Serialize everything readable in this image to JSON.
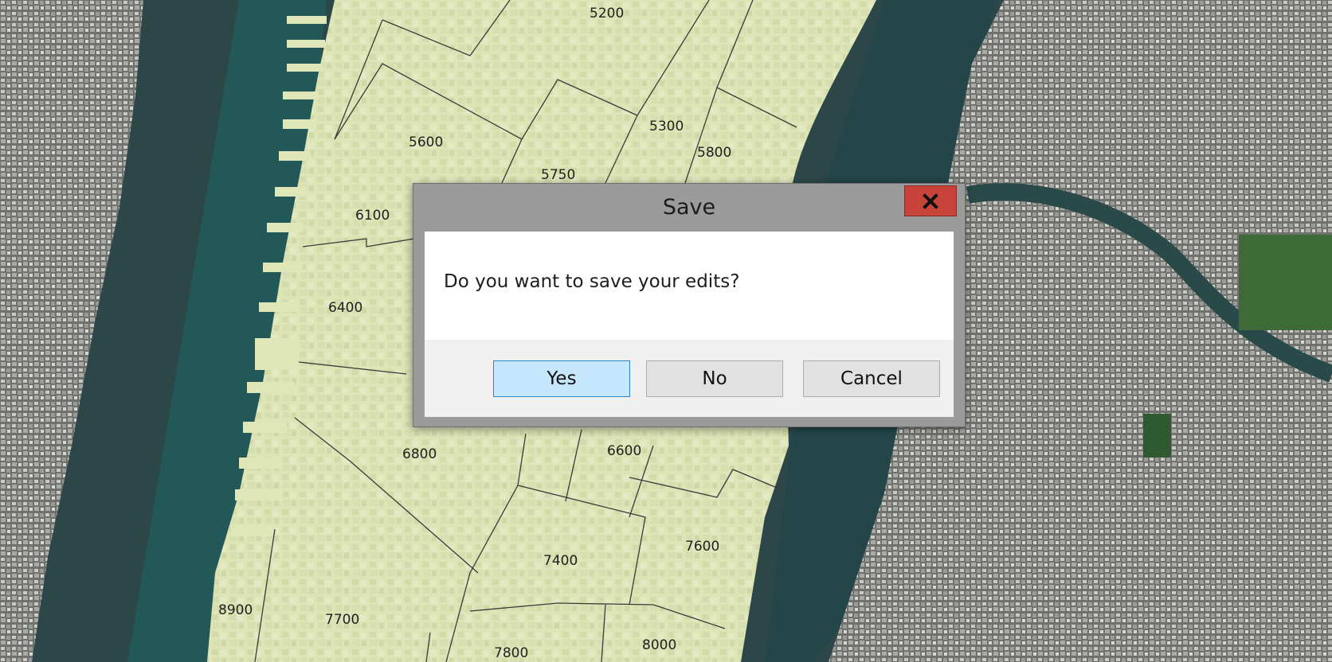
{
  "dialog": {
    "title": "Save",
    "message": "Do you want to save your edits?",
    "buttons": {
      "yes": "Yes",
      "no": "No",
      "cancel": "Cancel"
    },
    "close_icon": "close-icon"
  },
  "map": {
    "parcel_labels": [
      "5200",
      "5300",
      "5600",
      "5750",
      "5800",
      "6100",
      "6400",
      "6600",
      "6800",
      "7400",
      "7600",
      "7700",
      "7800",
      "8000",
      "8900"
    ]
  },
  "colors": {
    "water": "#2f4a4c",
    "parcel_fill": "#dfe6b7",
    "close_button": "#c8433a",
    "primary_button": "#c6e7fb",
    "primary_button_border": "#2f84c9"
  }
}
